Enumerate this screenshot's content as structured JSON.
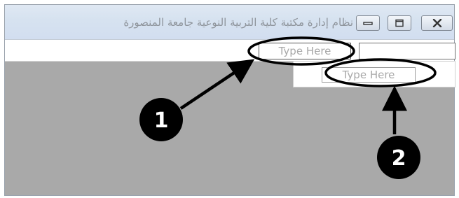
{
  "window": {
    "title": "نظام إدارة مكتبة كلية التربية النوعية جامعة المنصورة",
    "buttons": {
      "minimize_icon": "minimize-icon",
      "maximize_icon": "maximize-icon",
      "close_icon": "close-icon"
    }
  },
  "inputs": {
    "textbox_1_placeholder": "Type Here",
    "textbox_2_placeholder": "Type Here",
    "textbox_right_value": ""
  },
  "annotations": {
    "callout_1": "1",
    "callout_2": "2"
  },
  "colors": {
    "client_area": "#a9a9a9",
    "titlebar": "#d6e2f0",
    "annotation": "#000000"
  }
}
